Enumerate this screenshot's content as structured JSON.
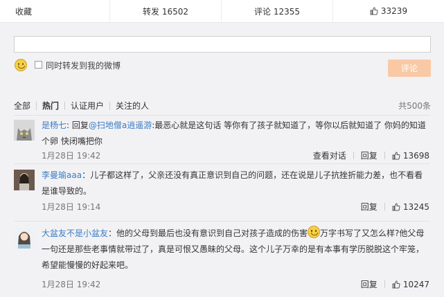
{
  "actionbar": {
    "favorite": "收藏",
    "repost": "转发 16502",
    "comment": "评论 12355",
    "like": "33239",
    "like_icon": "thumbs-up-icon"
  },
  "composer": {
    "value": "",
    "emoji_icon": "smiley-icon",
    "forward_label": "同时转发到我的微博",
    "submit_label": "评论",
    "submit_color": "#f9c9a5"
  },
  "filters": {
    "tabs": [
      "全部",
      "热门",
      "认证用户",
      "关注的人"
    ],
    "active": "热门",
    "total": "共500条"
  },
  "comments": [
    {
      "user": "是杨七",
      "sep": ": ",
      "reply_prefix": "回复",
      "mention": "@扫地僧a逍遥游",
      "text": ":最恶心就是这句话 等你有了孩子就知道了，等你以后就知道了 你妈的知道个卵 快闭嘴把你",
      "time": "1月28日 19:42",
      "view_reply": "查看对话",
      "reply": "回复",
      "likes": "13698"
    },
    {
      "user": "李曼瑜aaa",
      "sep": "：",
      "text": "儿子都这样了，父亲还没有真正意识到自己的问题，还在说是儿子抗挫折能力差，也不看看是谁导致的。",
      "time": "1月28日 19:14",
      "reply": "回复",
      "likes": "13245"
    },
    {
      "user": "大盆友不是小盆友",
      "sep": "：",
      "text_before": "他的父母到最后也没有意识到自己对孩子造成的伤害",
      "text_after": "万字书写了又怎么样?他父母一句还是那些老事情就带过了，真是可恨又愚昧的父母。这个儿子万幸的是有本事有学历脱脱这个牢笼，希望能慢慢的好起来吧。",
      "time": "1月28日 19:42",
      "reply": "回复",
      "likes": "10247"
    }
  ]
}
